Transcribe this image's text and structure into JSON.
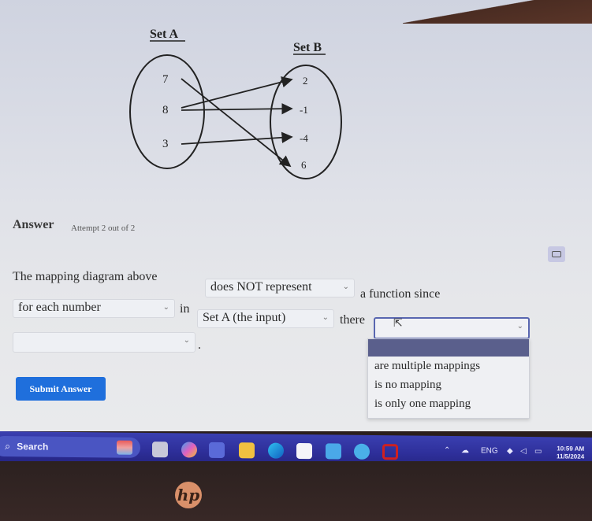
{
  "diagram": {
    "set_a_label": "Set A",
    "set_b_label": "Set B",
    "set_a": [
      "7",
      "8",
      "3"
    ],
    "set_b": [
      "2",
      "-1",
      "-4",
      "6"
    ],
    "mappings": [
      {
        "from": "7",
        "to": "6"
      },
      {
        "from": "8",
        "to": "2"
      },
      {
        "from": "8",
        "to": "-1"
      },
      {
        "from": "3",
        "to": "-4"
      }
    ]
  },
  "answer": {
    "title": "Answer",
    "attempt": "Attempt 2 out of 2"
  },
  "question": {
    "part1": "The mapping diagram above",
    "select1_value": "does NOT represent",
    "part2": "a function since",
    "select2_value": "for each number",
    "part3": "in",
    "select3_value": "Set A (the input)",
    "part4": "there",
    "select4_value": "",
    "select5_value": "",
    "end_punct": "."
  },
  "dropdown": {
    "options": [
      "",
      "are multiple mappings",
      "is no mapping",
      "is only one mapping"
    ]
  },
  "submit_label": "Submit Answer",
  "taskbar": {
    "search_label": "Search",
    "tray_language": "ENG",
    "clock_time": "10:59 AM",
    "clock_date": "11/5/2024"
  },
  "bezel": {
    "logo_text": "hp"
  }
}
